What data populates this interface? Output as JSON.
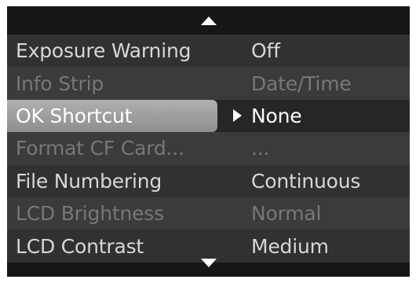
{
  "nav": {
    "scroll_up_icon": "triangle-up",
    "scroll_down_icon": "triangle-down",
    "selection_pointer_icon": "triangle-right"
  },
  "menu": {
    "items": [
      {
        "label": "Exposure Warning",
        "value": "Off",
        "state": "enabled"
      },
      {
        "label": "Info Strip",
        "value": "Date/Time",
        "state": "disabled"
      },
      {
        "label": "OK Shortcut",
        "value": "None",
        "state": "selected"
      },
      {
        "label": "Format CF Card...",
        "value": "...",
        "state": "disabled"
      },
      {
        "label": "File Numbering",
        "value": "Continuous",
        "state": "enabled"
      },
      {
        "label": "LCD Brightness",
        "value": "Normal",
        "state": "disabled"
      },
      {
        "label": "LCD Contrast",
        "value": "Medium",
        "state": "enabled"
      }
    ]
  },
  "colors": {
    "screen_background": "#161616",
    "row_odd": "#313131",
    "row_even": "#3b3b3b",
    "highlight": "#a0a0a0",
    "text_enabled": "#d7d7d7",
    "text_disabled": "#777777",
    "text_selected": "#ffffff"
  }
}
